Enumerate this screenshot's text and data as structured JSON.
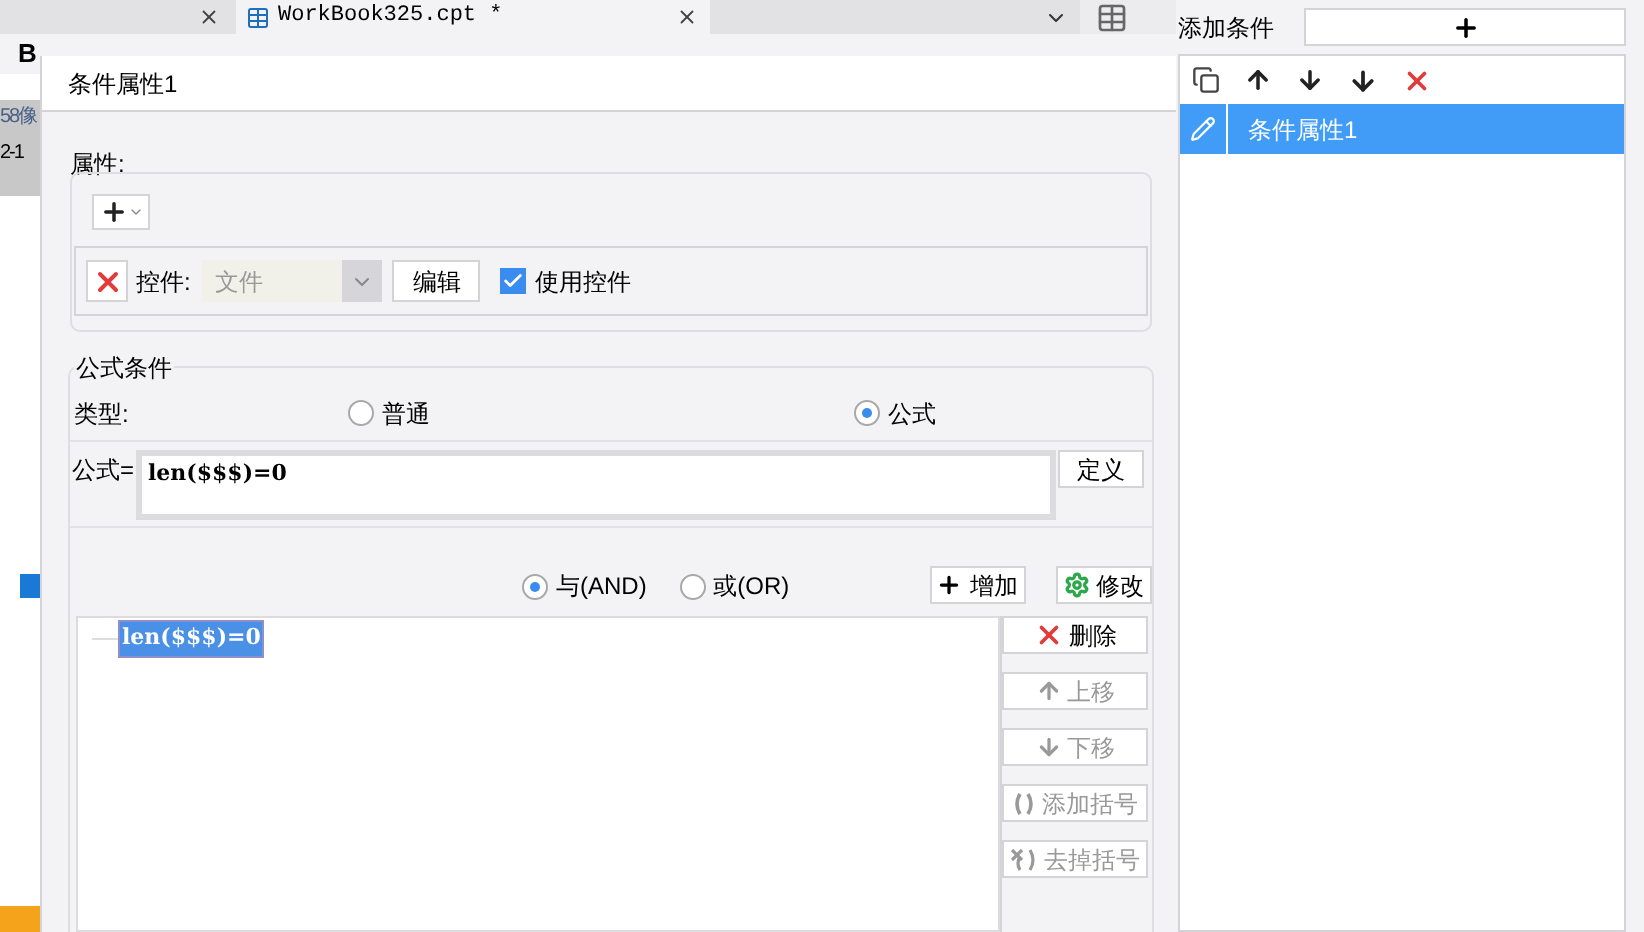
{
  "background_app": {
    "document_tab": {
      "title": "WorkBook325.cpt *",
      "selected": true
    },
    "toolbar_bold": "B",
    "sheet_cells": [
      "58像",
      "2-1"
    ]
  },
  "dialog": {
    "title": "条件属性1",
    "properties": {
      "legend": "属性:",
      "widget_label": "控件:",
      "widget_select": {
        "value": "文件",
        "disabled": true
      },
      "edit_button": "编辑",
      "use_widget": {
        "label": "使用控件",
        "checked": true
      }
    },
    "formula_condition": {
      "legend": "公式条件",
      "type_label": "类型:",
      "type_options": [
        {
          "label": "普通",
          "selected": false
        },
        {
          "label": "公式",
          "selected": true
        }
      ],
      "formula_label": "公式=",
      "formula_value": "len($$$)=0",
      "define_button": "定义",
      "join_options": [
        {
          "label": "与(AND)",
          "selected": true
        },
        {
          "label": "或(OR)",
          "selected": false
        }
      ],
      "add_button": "增加",
      "modify_button": "修改",
      "conditions": [
        {
          "text": "len($$$)=0",
          "selected": true
        }
      ],
      "side_buttons": [
        {
          "kind": "delete",
          "label": "删除",
          "disabled": false
        },
        {
          "kind": "up",
          "label": "上移",
          "disabled": true
        },
        {
          "kind": "down",
          "label": "下移",
          "disabled": true
        },
        {
          "kind": "add_paren",
          "label": "添加括号",
          "disabled": true
        },
        {
          "kind": "remove_paren",
          "label": "去掉括号",
          "disabled": true
        }
      ]
    }
  },
  "right_panel": {
    "add_label": "添加条件",
    "conditions": [
      {
        "label": "条件属性1",
        "selected": true
      }
    ]
  }
}
